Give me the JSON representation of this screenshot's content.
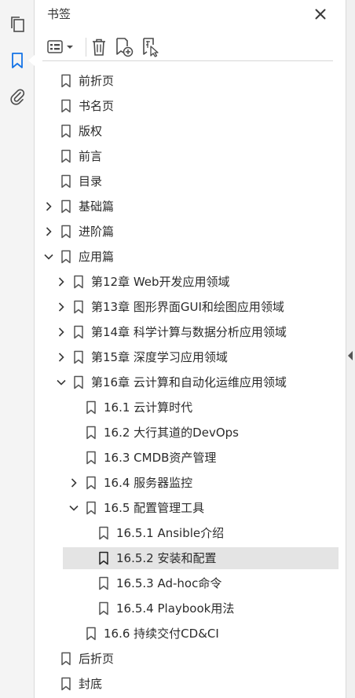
{
  "panel": {
    "title": "书签"
  },
  "icons": {
    "rail": [
      "pages-icon",
      "bookmarks-icon",
      "attachments-icon"
    ],
    "toolbar": [
      "options-menu-icon",
      "delete-icon",
      "new-bookmark-icon",
      "bookmark-from-selection-icon"
    ],
    "close": "close-icon"
  },
  "colors": {
    "active_rail": "#1473e6",
    "icon": "#4b4b4b",
    "selected_row": "#e4e4e4"
  },
  "tree": [
    {
      "label": "前折页",
      "level": 0,
      "toggle": "none"
    },
    {
      "label": "书名页",
      "level": 0,
      "toggle": "none"
    },
    {
      "label": "版权",
      "level": 0,
      "toggle": "none"
    },
    {
      "label": "前言",
      "level": 0,
      "toggle": "none"
    },
    {
      "label": "目录",
      "level": 0,
      "toggle": "none"
    },
    {
      "label": "基础篇",
      "level": 0,
      "toggle": "collapsed"
    },
    {
      "label": "进阶篇",
      "level": 0,
      "toggle": "collapsed"
    },
    {
      "label": "应用篇",
      "level": 0,
      "toggle": "expanded"
    },
    {
      "label": "第12章 Web开发应用领域",
      "level": 1,
      "toggle": "collapsed"
    },
    {
      "label": "第13章 图形界面GUI和绘图应用领域",
      "level": 1,
      "toggle": "collapsed"
    },
    {
      "label": "第14章 科学计算与数据分析应用领域",
      "level": 1,
      "toggle": "collapsed"
    },
    {
      "label": "第15章 深度学习应用领域",
      "level": 1,
      "toggle": "collapsed"
    },
    {
      "label": "第16章 云计算和自动化运维应用领域",
      "level": 1,
      "toggle": "expanded"
    },
    {
      "label": "16.1 云计算时代",
      "level": 2,
      "toggle": "none"
    },
    {
      "label": "16.2 大行其道的DevOps",
      "level": 2,
      "toggle": "none"
    },
    {
      "label": "16.3 CMDB资产管理",
      "level": 2,
      "toggle": "none"
    },
    {
      "label": "16.4 服务器监控",
      "level": 2,
      "toggle": "collapsed"
    },
    {
      "label": "16.5 配置管理工具",
      "level": 2,
      "toggle": "expanded"
    },
    {
      "label": "16.5.1 Ansible介绍",
      "level": 3,
      "toggle": "none"
    },
    {
      "label": "16.5.2 安装和配置",
      "level": 3,
      "toggle": "none",
      "selected": true
    },
    {
      "label": "16.5.3 Ad-hoc命令",
      "level": 3,
      "toggle": "none"
    },
    {
      "label": "16.5.4 Playbook用法",
      "level": 3,
      "toggle": "none"
    },
    {
      "label": "16.6 持续交付CD&CI",
      "level": 2,
      "toggle": "none"
    },
    {
      "label": "后折页",
      "level": 0,
      "toggle": "none"
    },
    {
      "label": "封底",
      "level": 0,
      "toggle": "none"
    }
  ]
}
